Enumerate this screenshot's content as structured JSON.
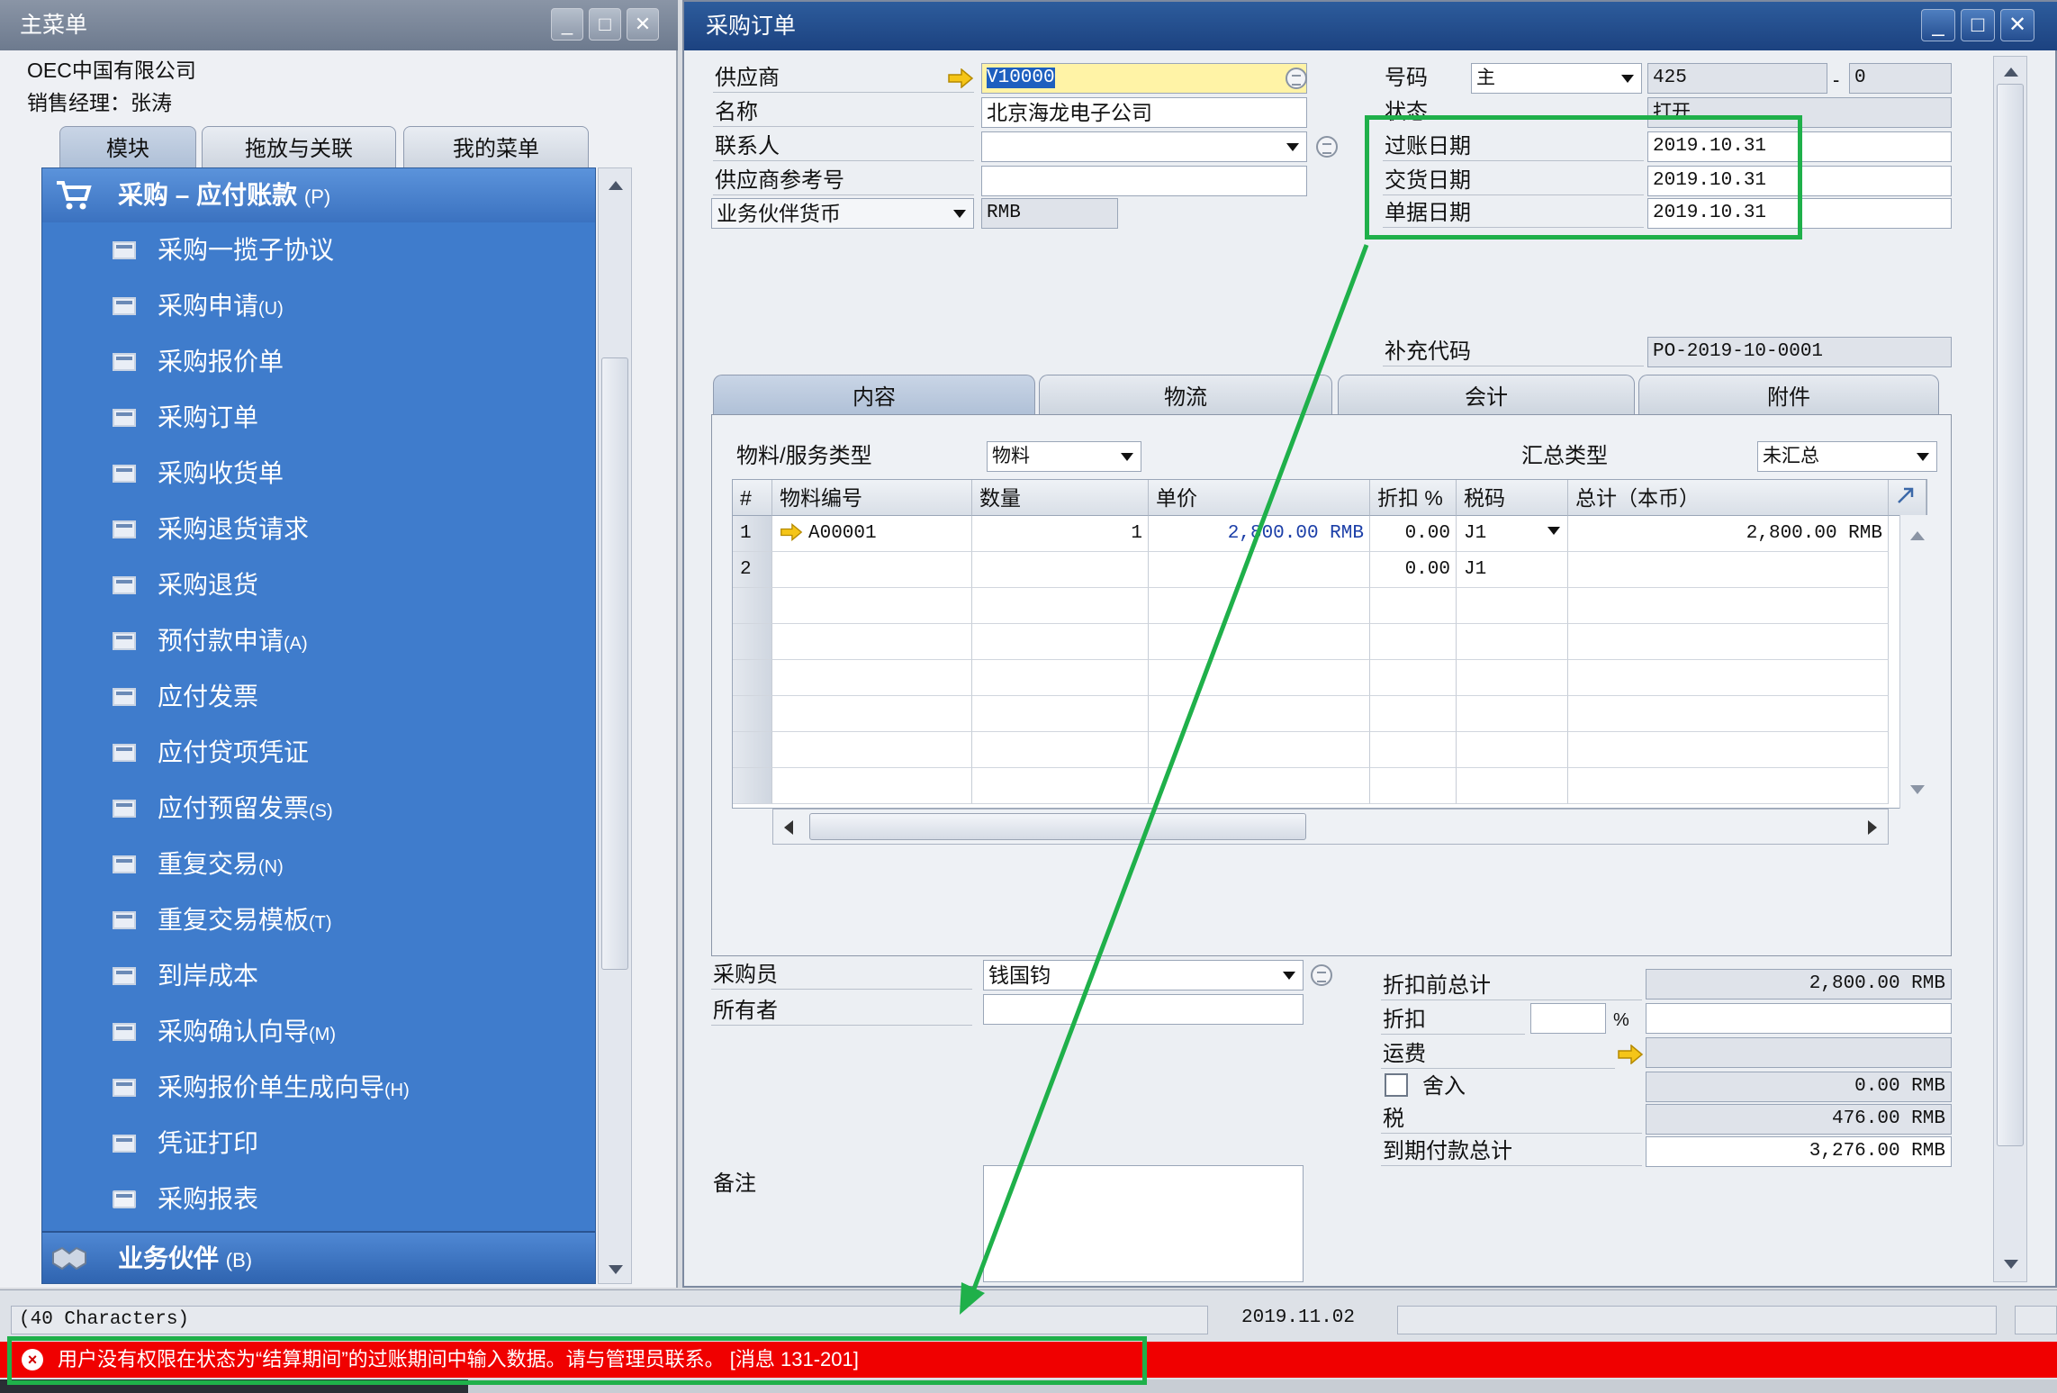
{
  "main_menu": {
    "title": "主菜单",
    "company": "OEC中国有限公司",
    "manager": "销售经理：张涛",
    "tabs": [
      "模块",
      "拖放与关联",
      "我的菜单"
    ],
    "section_title": "采购 – 应付账款",
    "section_shortcut": "(P)",
    "items": [
      {
        "label": "采购一揽子协议",
        "sc": ""
      },
      {
        "label": "采购申请",
        "sc": "(U)"
      },
      {
        "label": "采购报价单",
        "sc": ""
      },
      {
        "label": "采购订单",
        "sc": ""
      },
      {
        "label": "采购收货单",
        "sc": ""
      },
      {
        "label": "采购退货请求",
        "sc": ""
      },
      {
        "label": "采购退货",
        "sc": ""
      },
      {
        "label": "预付款申请",
        "sc": "(A)"
      },
      {
        "label": "应付发票",
        "sc": ""
      },
      {
        "label": "应付贷项凭证",
        "sc": ""
      },
      {
        "label": "应付预留发票",
        "sc": "(S)"
      },
      {
        "label": "重复交易",
        "sc": "(N)"
      },
      {
        "label": "重复交易模板",
        "sc": "(T)"
      },
      {
        "label": "到岸成本",
        "sc": ""
      },
      {
        "label": "采购确认向导",
        "sc": "(M)"
      },
      {
        "label": "采购报价单生成向导",
        "sc": "(H)"
      },
      {
        "label": "凭证打印",
        "sc": ""
      },
      {
        "label": "采购报表",
        "sc": ""
      }
    ],
    "next_section": "业务伙伴",
    "next_section_sc": "(B)"
  },
  "po": {
    "title": "采购订单",
    "labels": {
      "supplier": "供应商",
      "name": "名称",
      "contact": "联系人",
      "supplier_ref": "供应商参考号",
      "currency_type": "业务伙伴货币",
      "number": "号码",
      "status": "状态",
      "posting_date": "过账日期",
      "delivery_date": "交货日期",
      "doc_date": "单据日期",
      "supplement_code": "补充代码"
    },
    "values": {
      "supplier": "V10000",
      "name": "北京海龙电子公司",
      "contact": "",
      "supplier_ref": "",
      "currency": "RMB",
      "series": "主",
      "number": "425",
      "number_suffix": "0",
      "status": "打开",
      "posting_date": "2019.10.31",
      "delivery_date": "2019.10.31",
      "doc_date": "2019.10.31",
      "supplement_code": "PO-2019-10-0001",
      "number_dash": "-"
    },
    "tabs": [
      "内容",
      "物流",
      "会计",
      "附件"
    ],
    "item_type_label": "物料/服务类型",
    "item_type_value": "物料",
    "summary_type_label": "汇总类型",
    "summary_type_value": "未汇总",
    "grid_headers": [
      "#",
      "物料编号",
      "数量",
      "单价",
      "折扣 %",
      "税码",
      "总计（本币）"
    ],
    "rows": [
      {
        "n": "1",
        "item": "A00001",
        "qty": "1",
        "price": "2,800.00 RMB",
        "disc": "0.00",
        "tax": "J1",
        "total": "2,800.00 RMB"
      },
      {
        "n": "2",
        "item": "",
        "qty": "",
        "price": "",
        "disc": "0.00",
        "tax": "J1",
        "total": ""
      }
    ],
    "buyer_label": "采购员",
    "buyer_value": "钱国钧",
    "owner_label": "所有者",
    "owner_value": "",
    "remarks_label": "备注",
    "totals": {
      "before_disc_label": "折扣前总计",
      "before_disc": "2,800.00 RMB",
      "disc_label": "折扣",
      "disc_pct": "",
      "pct_sign": "%",
      "disc_amt": "",
      "freight_label": "运费",
      "freight": "",
      "rounding_label": "舍入",
      "rounding": "0.00 RMB",
      "tax_label": "税",
      "tax": "476.00 RMB",
      "due_label": "到期付款总计",
      "due": "3,276.00 RMB"
    }
  },
  "status_bar": {
    "chars": "(40 Characters)",
    "date": "2019.11.02",
    "error": "用户没有权限在状态为“结算期间”的过账期间中输入数据。请与管理员联系。   [消息 131-201]",
    "error_icon": "×"
  },
  "colors": {
    "menu_blue": "#3f7ccc",
    "title_blue": "#1c4280",
    "error_red": "#f00000",
    "annotation_green": "#1fb04a",
    "supplier_highlight": "#fff3a6"
  }
}
